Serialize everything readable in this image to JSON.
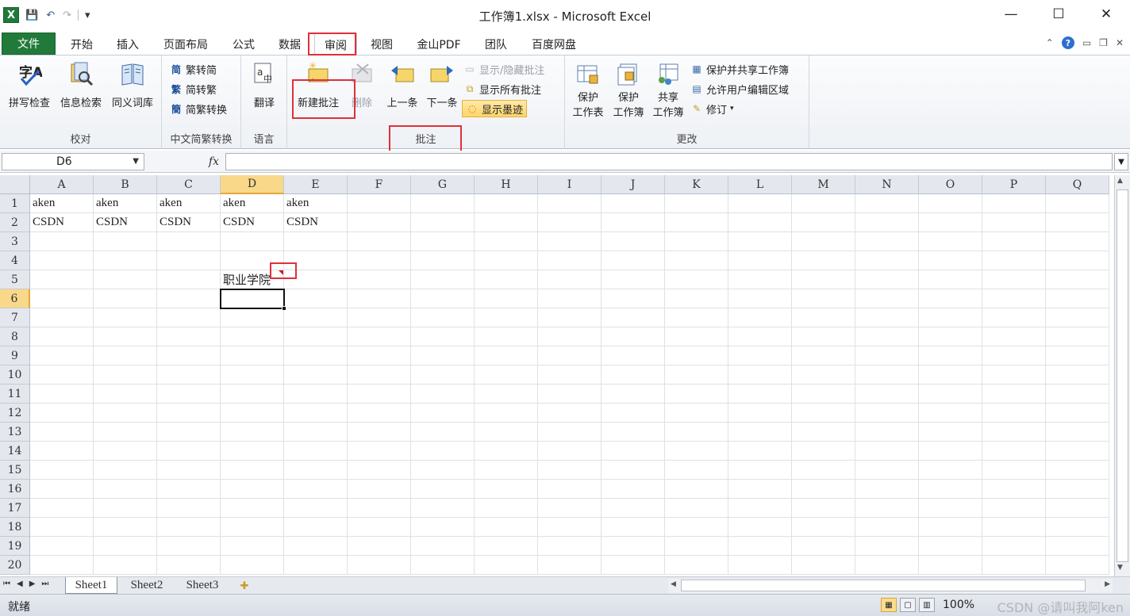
{
  "window": {
    "title": "工作簿1.xlsx - Microsoft Excel",
    "minimize": "—",
    "maximize": "☐",
    "close": "✕"
  },
  "qat": {
    "logo": "X",
    "save": "💾",
    "undo": "↶",
    "redo": "↷",
    "customize": "▾"
  },
  "tabs": {
    "file": "文件",
    "items": [
      "开始",
      "插入",
      "页面布局",
      "公式",
      "数据",
      "审阅",
      "视图",
      "金山PDF",
      "团队",
      "百度网盘"
    ],
    "active": "审阅"
  },
  "ribbon": {
    "proofing": {
      "label": "校对",
      "spelling": "拼写检查",
      "research": "信息检索",
      "thesaurus": "同义词库"
    },
    "chinese_conversion": {
      "label": "中文简繁转换",
      "to_simplified": "繁转简",
      "to_traditional": "简转繁",
      "convert": "简繁转换"
    },
    "language": {
      "label": "语言",
      "translate": "翻译"
    },
    "comments": {
      "label": "批注",
      "new_comment": "新建批注",
      "delete": "删除",
      "previous": "上一条",
      "next": "下一条",
      "show_hide": "显示/隐藏批注",
      "show_all": "显示所有批注",
      "show_ink": "显示墨迹"
    },
    "changes": {
      "label": "更改",
      "protect_sheet_1": "保护",
      "protect_sheet_2": "工作表",
      "protect_workbook_1": "保护",
      "protect_workbook_2": "工作簿",
      "share_workbook_1": "共享",
      "share_workbook_2": "工作簿",
      "protect_share": "保护并共享工作簿",
      "allow_edit": "允许用户编辑区域",
      "track_changes": "修订"
    }
  },
  "formula_bar": {
    "name_box": "D6",
    "fx": "fx",
    "value": ""
  },
  "grid": {
    "columns": [
      "A",
      "B",
      "C",
      "D",
      "E",
      "F",
      "G",
      "H",
      "I",
      "J",
      "K",
      "L",
      "M",
      "N",
      "O",
      "P",
      "Q"
    ],
    "rows": [
      "1",
      "2",
      "3",
      "4",
      "5",
      "6",
      "7",
      "8",
      "9",
      "10",
      "11",
      "12",
      "13",
      "14",
      "15",
      "16",
      "17",
      "18",
      "19",
      "20"
    ],
    "selected_column": "D",
    "selected_row": "6",
    "cells": {
      "A1": "aken",
      "B1": "aken",
      "C1": "aken",
      "D1": "aken",
      "E1": "aken",
      "A2": "CSDN",
      "B2": "CSDN",
      "C2": "CSDN",
      "D2": "CSDN",
      "E2": "CSDN",
      "D5": "职业学院"
    }
  },
  "sheets": {
    "tabs": [
      "Sheet1",
      "Sheet2",
      "Sheet3"
    ],
    "active": "Sheet1",
    "new_sheet_icon": "insert-sheet-icon"
  },
  "status": {
    "ready": "就绪",
    "zoom": "100%",
    "watermark": "CSDN @请叫我阿ken"
  },
  "colors": {
    "file_tab": "#217a3a",
    "highlight_box": "#e0303a",
    "selected_header": "#f9d88a",
    "comment_indicator": "#d21a1a"
  }
}
